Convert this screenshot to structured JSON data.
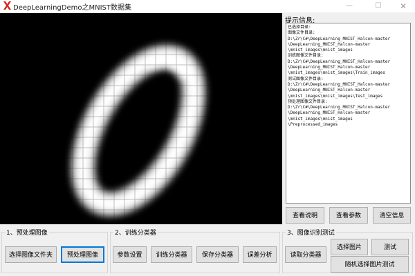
{
  "window": {
    "title": "DeepLearningDemo之MNIST数据集",
    "minimize_glyph": "—",
    "maximize_glyph": "☐",
    "close_glyph": "✕",
    "accent_color": "#0078d7"
  },
  "info_panel": {
    "label": "提示信息:",
    "lines": [
      "已选择目录:",
      "图像文件目录:",
      "D:\\Zr\\C#\\DeepLearning_MNIST_Halcon-master",
      "\\DeepLearning_MNIST_Halcon-master",
      "\\mnist_images\\mnist_images",
      "训练图像文件目录:",
      "D:\\Zr\\C#\\DeepLearning_MNIST_Halcon-master",
      "\\DeepLearning_MNIST_Halcon-master",
      "\\mnist_images\\mnist_images\\Train_images",
      "测试图像文件目录:",
      "D:\\Zr\\C#\\DeepLearning_MNIST_Halcon-master",
      "\\DeepLearning_MNIST_Halcon-master",
      "\\mnist_images\\mnist_images\\Test_images",
      "预处理图像文件目录:",
      "D:\\Zr\\C#\\DeepLearning_MNIST_Halcon-master",
      "\\DeepLearning_MNIST_Halcon-master",
      "\\mnist_images\\mnist_images",
      "\\Preprocessed_images"
    ]
  },
  "info_buttons": {
    "view_help": "查看说明",
    "view_params": "查看参数",
    "clear_info": "清空信息"
  },
  "groups": {
    "preprocess": {
      "label": "1、预处理图像",
      "select_folder": "选择图像文件夹",
      "preprocess_images": "预处理图像"
    },
    "train": {
      "label": "2、训练分类器",
      "param_settings": "参数设置",
      "train_classifier": "训练分类器",
      "save_classifier": "保存分类器",
      "error_analysis": "误差分析"
    },
    "recognize": {
      "label": "3、图像识别测试",
      "read_classifier": "读取分类器",
      "select_image": "选择图片",
      "test": "测试",
      "random_select_test": "随机选择图片测试"
    }
  }
}
